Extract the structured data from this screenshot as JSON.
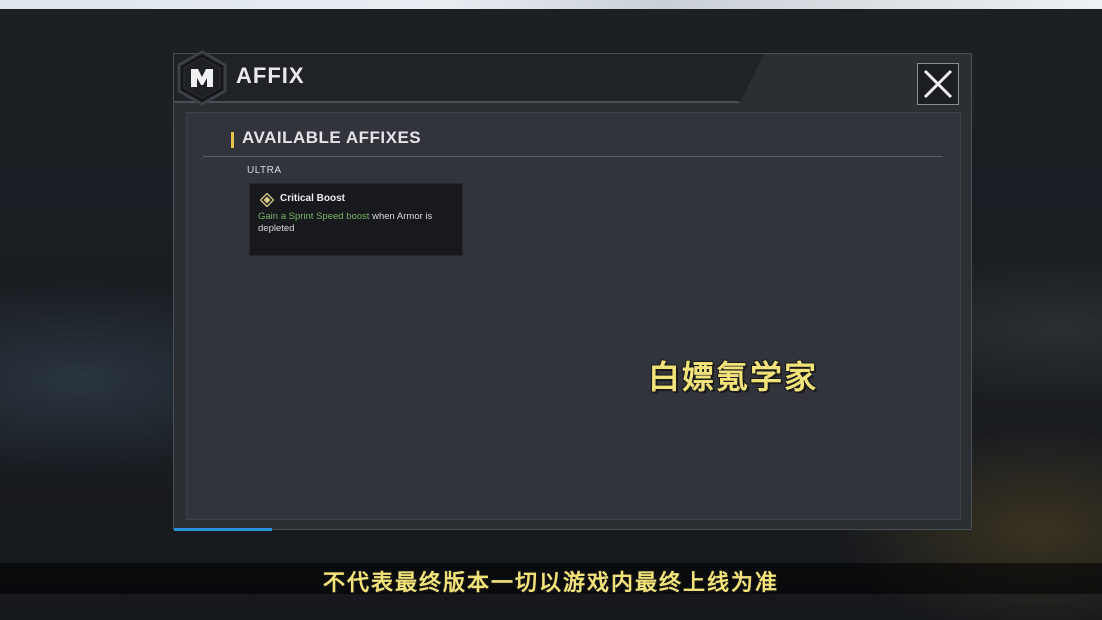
{
  "top_strip": {
    "text": ""
  },
  "dialog": {
    "title": "AFFIX",
    "logo_icon": "m-hexagon-logo-icon",
    "close_icon": "close-x-icon",
    "section_title": "AVAILABLE AFFIXES",
    "tiers": [
      {
        "label": "ULTRA",
        "affixes": [
          {
            "name": "Critical Boost",
            "icon": "affix-diamond-icon",
            "desc_highlight": "Gain a Sprint Speed boost",
            "desc_rest": " when Armor is depleted"
          }
        ]
      }
    ]
  },
  "overlay": {
    "watermark": "白嫖氪学家",
    "subtitle": "不代表最终版本一切以游戏内最终上线为准"
  },
  "colors": {
    "accent_yellow": "#e6c24a",
    "highlight_green": "#7ab36a",
    "progress_blue": "#2a8fd6",
    "overlay_text": "#f2e27a"
  }
}
